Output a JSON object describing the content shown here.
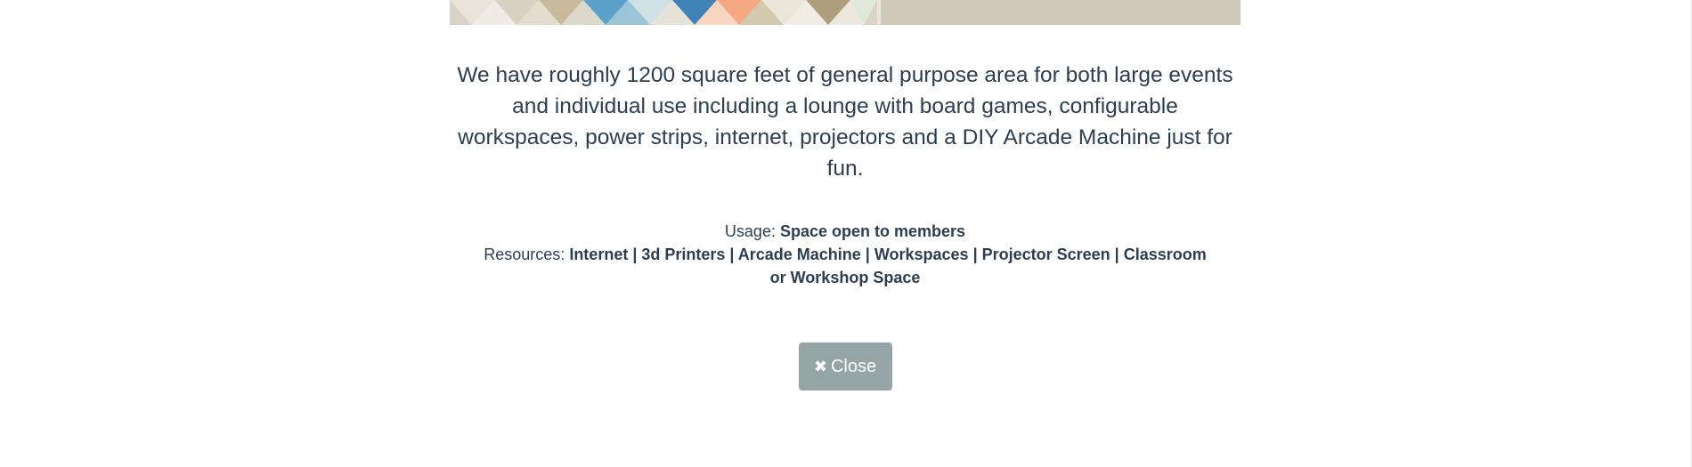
{
  "modal": {
    "description": "We have roughly 1200 square feet of general purpose area for both large events and individual use including a lounge with board games, configurable workspaces, power strips, internet, projectors and a DIY Arcade Machine just for fun.",
    "usage_label": "Usage:",
    "usage_value": "Space open to members",
    "resources_label": "Resources:",
    "resources_value": "Internet | 3d Printers | Arcade Machine | Workspaces | Projector Screen | Classroom or Workshop Space",
    "close_label": "Close",
    "close_icon": "close-icon"
  },
  "colors": {
    "text": "#2c3e50",
    "button_bg": "#95a5a6",
    "button_text": "#ffffff",
    "background": "#ffffff"
  }
}
